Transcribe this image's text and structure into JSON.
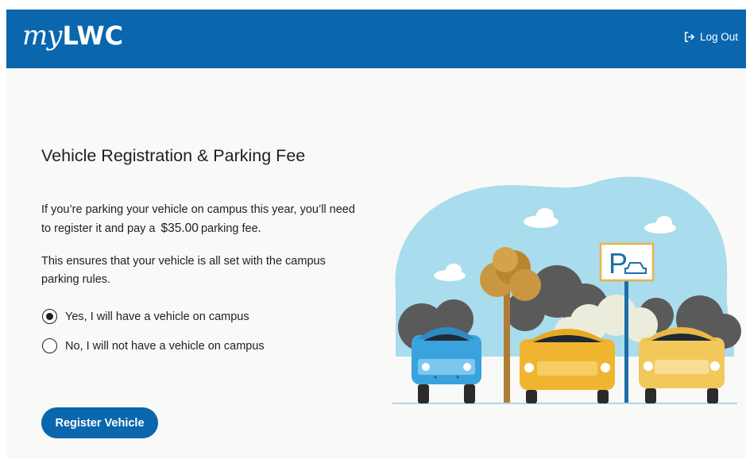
{
  "header": {
    "logo_prefix": "my",
    "logo_brand": "LWC",
    "logout_label": "Log Out",
    "background": "#0a67ad"
  },
  "main": {
    "title": "Vehicle Registration & Parking Fee",
    "paragraph1_before": "If you’re parking your vehicle on campus this year, you’ll need to register it and pay a",
    "fee": "$35.00",
    "paragraph1_after": "parking fee.",
    "paragraph2": "This ensures that your vehicle is all set with the campus parking rules.",
    "options": [
      {
        "label": "Yes, I will have a vehicle on campus",
        "selected": true
      },
      {
        "label": "No, I will not have a vehicle on campus",
        "selected": false
      }
    ],
    "register_button": "Register Vehicle"
  },
  "illustration": {
    "icons": [
      "parking-sign-icon",
      "car-icon"
    ],
    "sign_letter": "P"
  }
}
